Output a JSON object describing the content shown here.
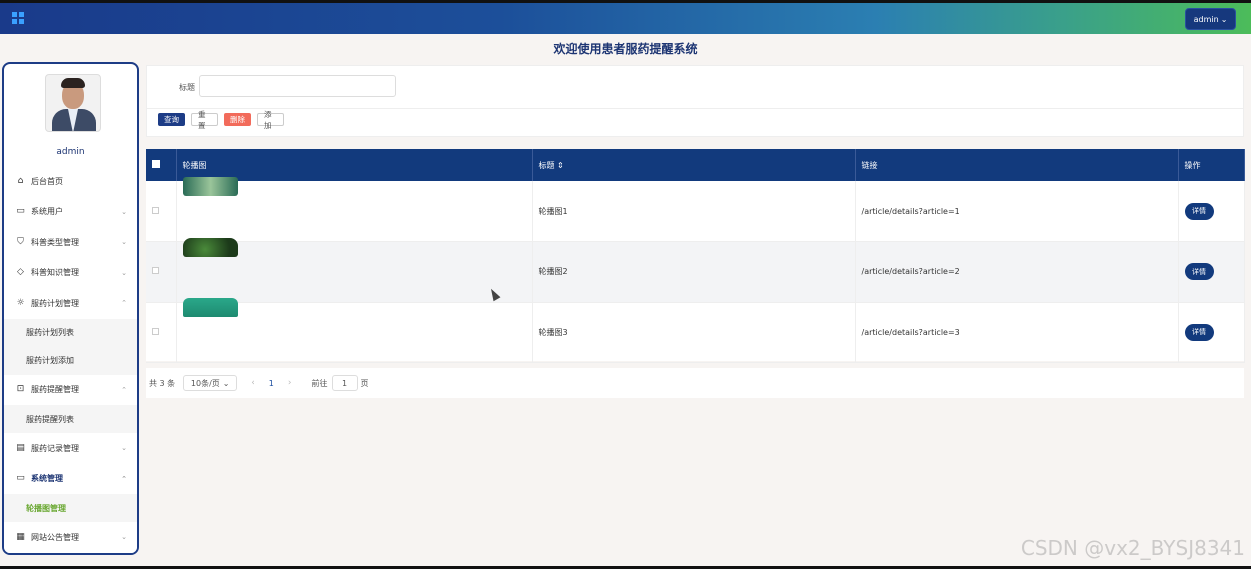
{
  "header": {
    "user_button": "admin"
  },
  "page_title": "欢迎使用患者服药提醒系统",
  "sidebar": {
    "username": "admin",
    "items": [
      {
        "label": "后台首页",
        "icon": "home-icon"
      },
      {
        "label": "系统用户",
        "icon": "monitor-icon"
      },
      {
        "label": "科普类型管理",
        "icon": "bookmark-icon"
      },
      {
        "label": "科普知识管理",
        "icon": "tag-icon"
      },
      {
        "label": "服药计划管理",
        "icon": "sun-icon"
      },
      {
        "label": "服药计划列表"
      },
      {
        "label": "服药计划添加"
      },
      {
        "label": "服药提醒管理",
        "icon": "inbox-icon"
      },
      {
        "label": "服药提醒列表"
      },
      {
        "label": "服药记录管理",
        "icon": "clipboard-icon"
      },
      {
        "label": "系统管理",
        "icon": "message-icon"
      },
      {
        "label": "轮播图管理"
      },
      {
        "label": "网站公告管理",
        "icon": "calendar-icon"
      }
    ]
  },
  "search": {
    "label": "标题",
    "value": "",
    "buttons": {
      "query": "查询",
      "reset": "重置",
      "delete": "删除",
      "add": "添加"
    }
  },
  "table": {
    "columns": [
      "轮播图",
      "标题",
      "链接",
      "操作"
    ],
    "rows": [
      {
        "title": "轮播图1",
        "link": "/article/details?article=1",
        "action": "详情"
      },
      {
        "title": "轮播图2",
        "link": "/article/details?article=2",
        "action": "详情"
      },
      {
        "title": "轮播图3",
        "link": "/article/details?article=3",
        "action": "详情"
      }
    ]
  },
  "pagination": {
    "total": "共 3 条",
    "page_size": "10条/页",
    "current_page": "1",
    "goto_label": "前往",
    "goto_value": "1",
    "page_unit": "页"
  },
  "watermark": "CSDN @vx2_BYSJ8341"
}
